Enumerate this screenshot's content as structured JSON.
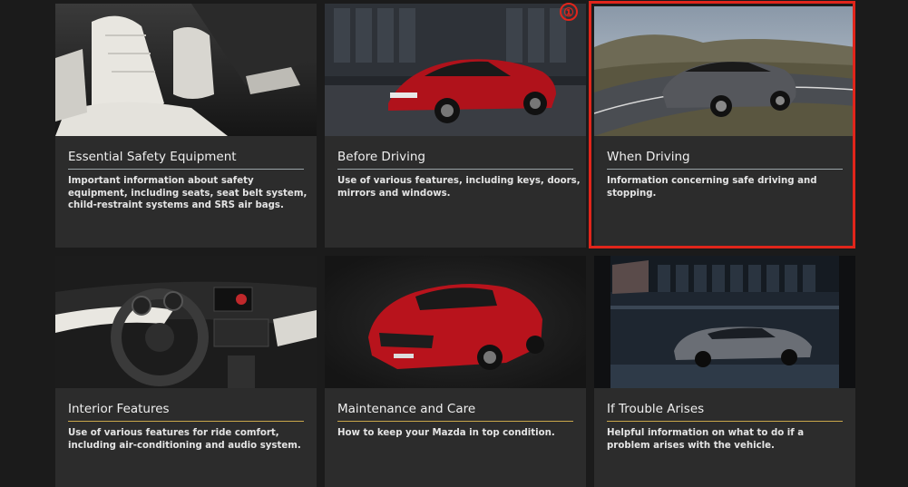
{
  "accent_color": "#e1251b",
  "cards": [
    {
      "title": "Essential Safety Equipment",
      "description": "Important information about safety equipment, including seats, seat belt system, child-restraint systems and SRS air bags.",
      "image": "white-leather-seats-interior",
      "rule_color": "#9aa3a8"
    },
    {
      "title": "Before Driving",
      "description": "Use of various features, including keys, doors, mirrors and windows.",
      "image": "red-sedan-front-building",
      "rule_color": "#9aa3a8"
    },
    {
      "title": "When Driving",
      "description": "Information concerning safe driving and stopping.",
      "image": "grey-wagon-mountain-road",
      "rule_color": "#9aa3a8"
    },
    {
      "title": "Interior Features",
      "description": "Use of various features for ride comfort, including air-conditioning and audio system.",
      "image": "dashboard-steering-wheel",
      "rule_color": "#c9a64a"
    },
    {
      "title": "Maintenance and Care",
      "description": "How to keep your Mazda in top condition.",
      "image": "red-sedan-studio",
      "rule_color": "#c9a64a"
    },
    {
      "title": "If Trouble Arises",
      "description": "Helpful information on what to do if a problem arises with the vehicle.",
      "image": "grey-sedan-night-city",
      "rule_color": "#c9a64a"
    }
  ],
  "step_marker": "①"
}
